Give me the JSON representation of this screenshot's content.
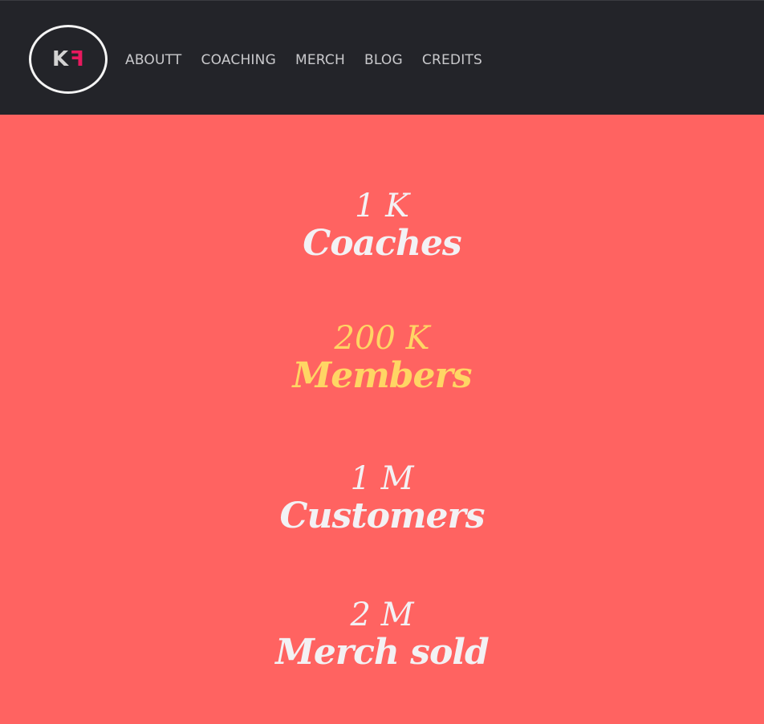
{
  "logo": {
    "letter_left": "K",
    "letter_right": "F"
  },
  "nav": {
    "items": [
      "ABOUTT",
      "COACHING",
      "MERCH",
      "BLOG",
      "CREDITS"
    ]
  },
  "stats": [
    {
      "value": "1 K",
      "label": "Coaches"
    },
    {
      "value": "200 K",
      "label": "Members"
    },
    {
      "value": "1 M",
      "label": "Customers"
    },
    {
      "value": "2 M",
      "label": "Merch sold"
    }
  ],
  "colors": {
    "header_bg": "#232429",
    "page_bg": "#ff6361",
    "stat_text": "#f3f1f4",
    "highlight": "#ffd564",
    "logo_accent": "#e8195e"
  }
}
